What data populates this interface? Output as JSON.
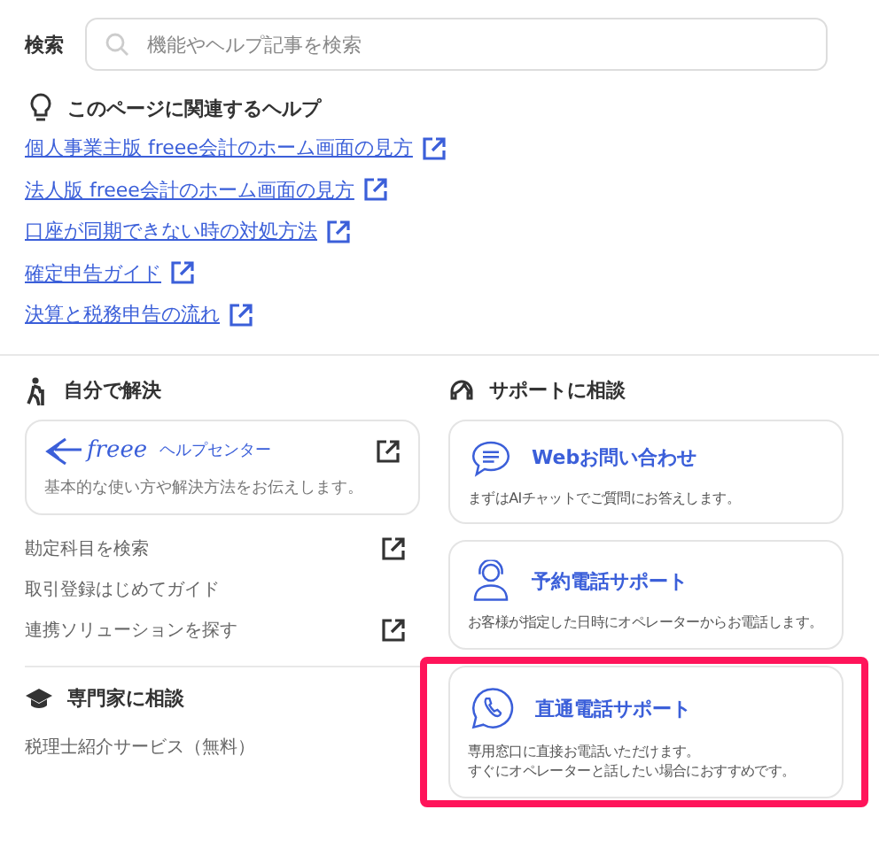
{
  "search": {
    "label": "検索",
    "placeholder": "機能やヘルプ記事を検索"
  },
  "related_help": {
    "title": "このページに関連するヘルプ",
    "links": [
      {
        "text": "個人事業主版 freee会計のホーム画面の見方"
      },
      {
        "text": "法人版 freee会計のホーム画面の見方"
      },
      {
        "text": "口座が同期できない時の対処方法"
      },
      {
        "text": "確定申告ガイド"
      },
      {
        "text": "決算と税務申告の流れ"
      }
    ]
  },
  "self_solve": {
    "title": "自分で解決",
    "help_center": {
      "logo_text": "freee",
      "title": "ヘルプセンター",
      "description": "基本的な使い方や解決方法をお伝えします。"
    },
    "links": [
      {
        "text": "勘定科目を検索",
        "external": true
      },
      {
        "text": "取引登録はじめてガイド",
        "external": false
      },
      {
        "text": "連携ソリューションを探す",
        "external": true
      }
    ]
  },
  "expert": {
    "title": "専門家に相談",
    "links": [
      {
        "text": "税理士紹介サービス（無料）"
      }
    ]
  },
  "support": {
    "title": "サポートに相談",
    "cards": [
      {
        "kind": "chat",
        "title": "Webお問い合わせ",
        "description": [
          "まずはAIチャットでご質問にお答えします。"
        ],
        "highlighted": false
      },
      {
        "kind": "operator",
        "title": "予約電話サポート",
        "description": [
          "お客様が指定した日時にオペレーターからお電話します。"
        ],
        "highlighted": false
      },
      {
        "kind": "phone",
        "title": "直通電話サポート",
        "description": [
          "専用窓口に直接お電話いただけます。",
          "すぐにオペレーターと話したい場合におすすめです。"
        ],
        "highlighted": true
      }
    ]
  }
}
